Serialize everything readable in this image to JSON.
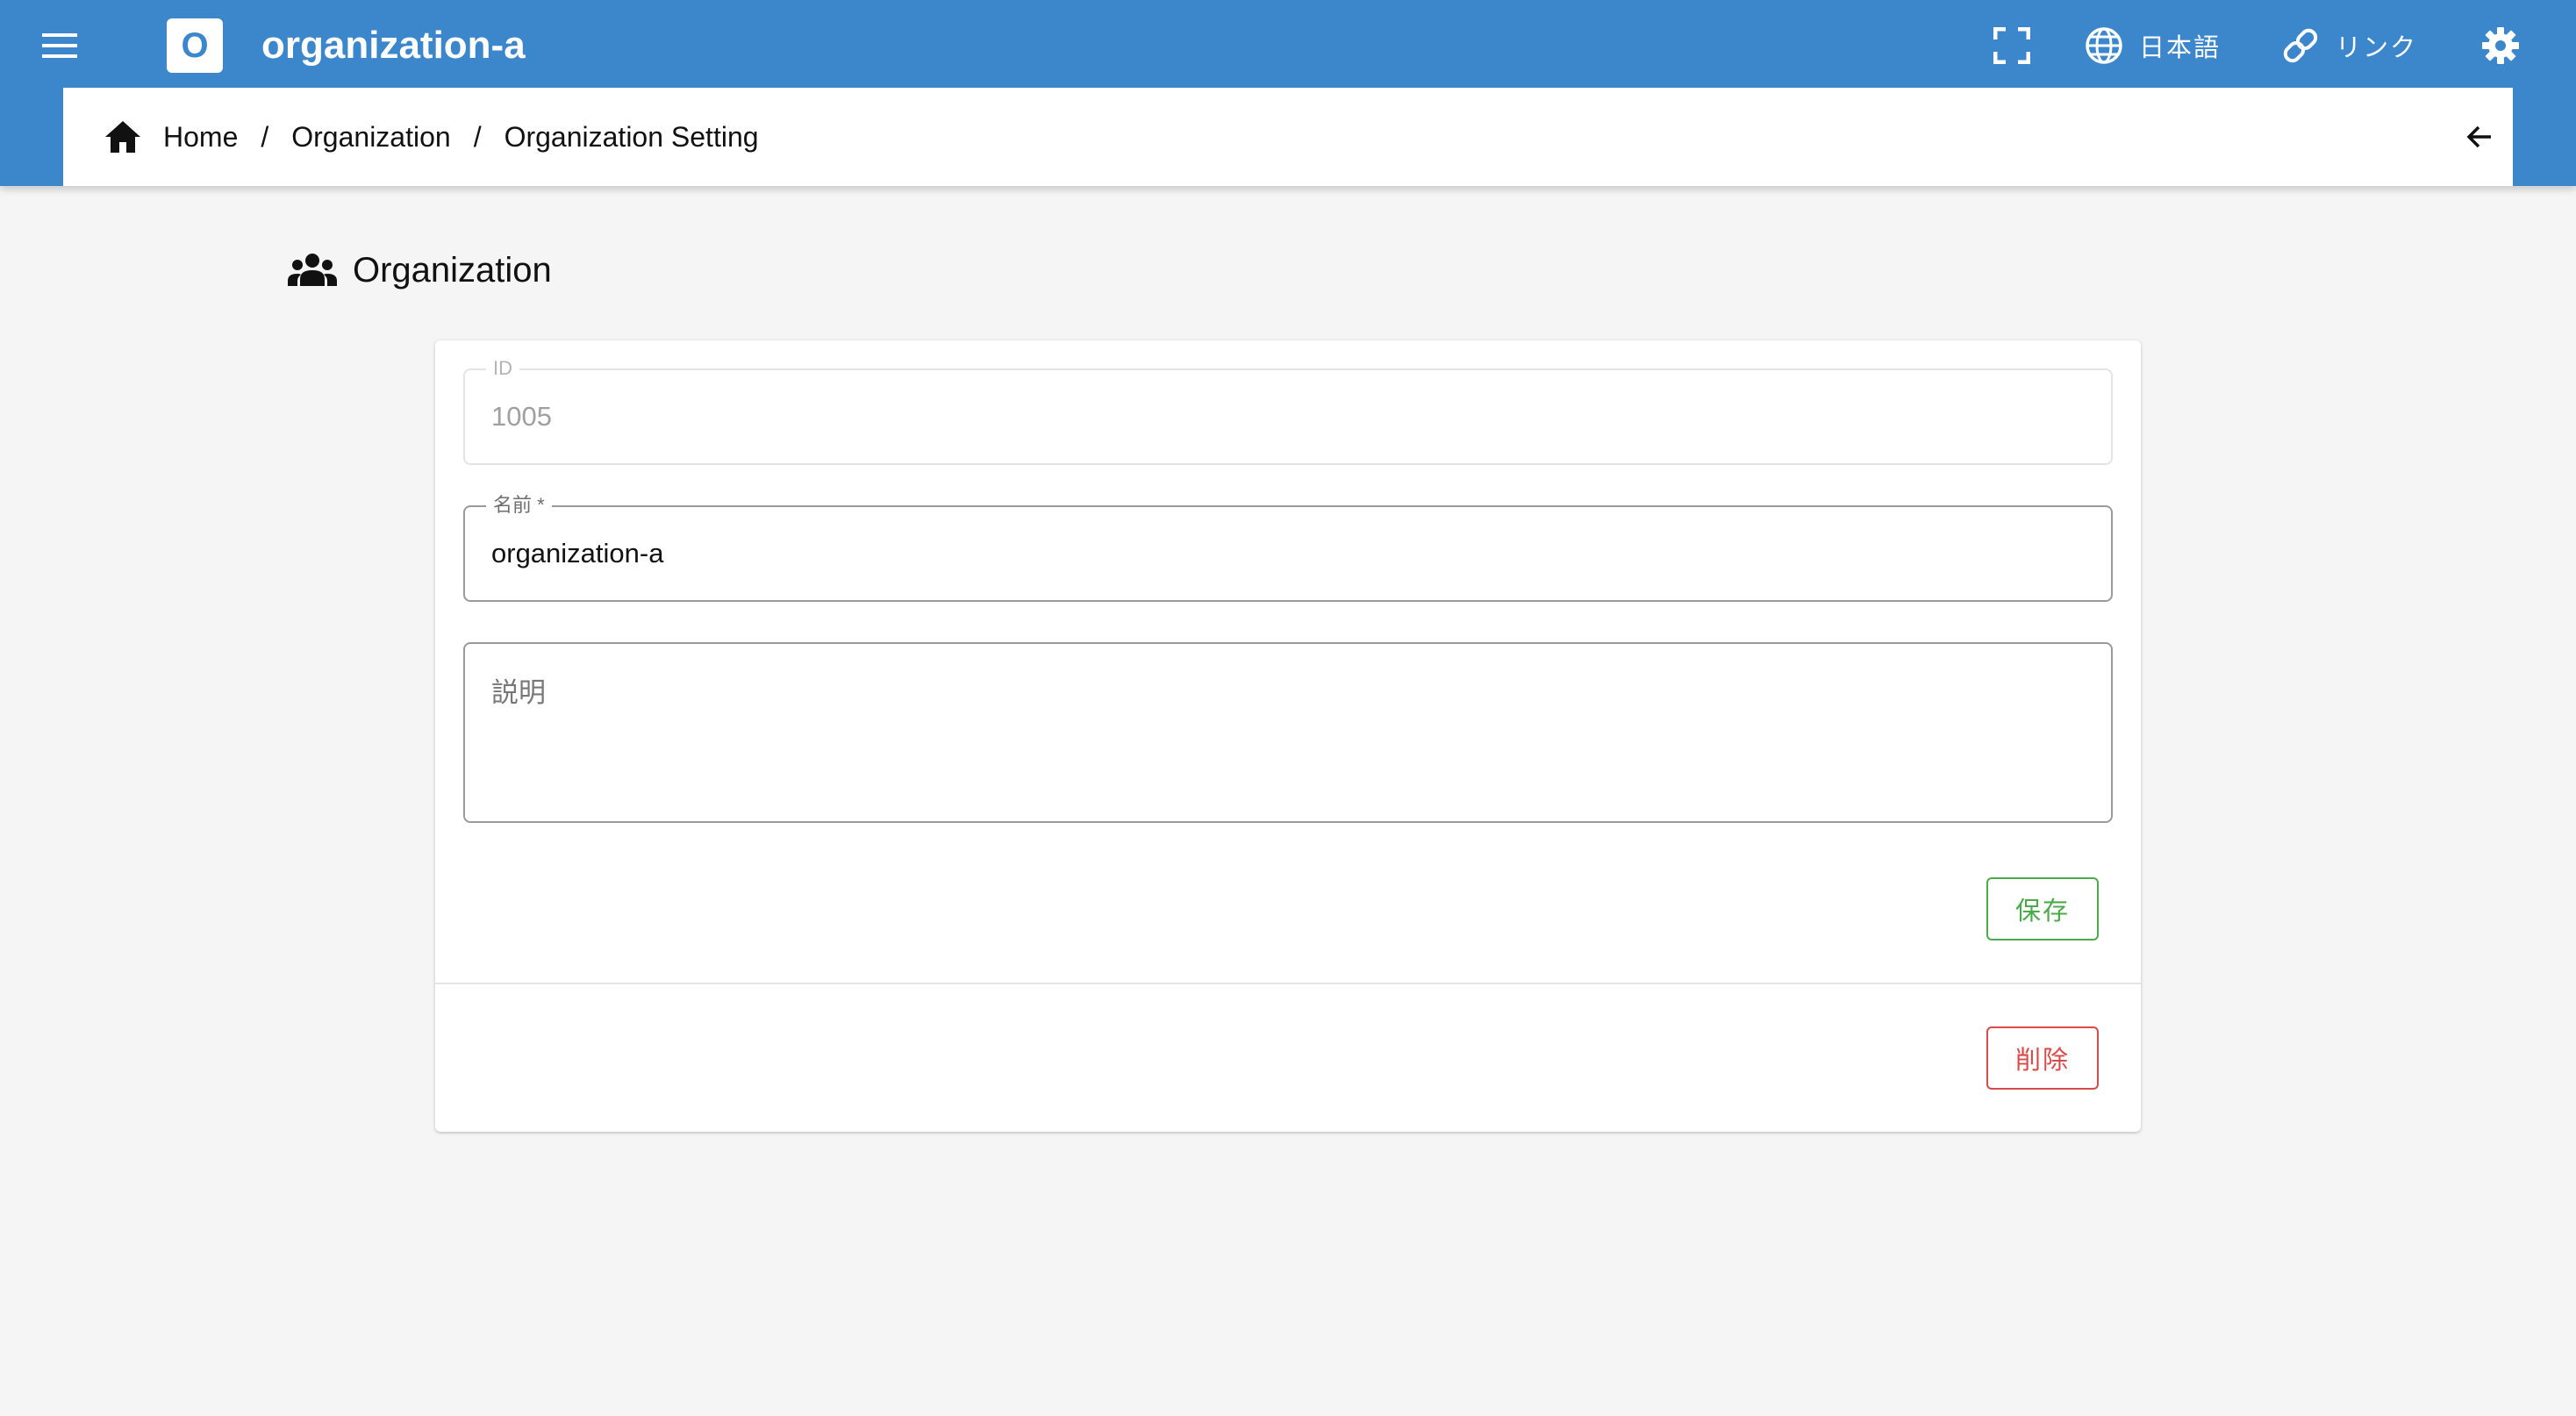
{
  "appbar": {
    "title": "organization-a",
    "logo_letter": "O",
    "language_label": "日本語",
    "link_label": "リンク",
    "icons": [
      "menu-icon",
      "fullscreen-icon",
      "globe-icon",
      "link-icon",
      "gear-icon"
    ],
    "color": "#3c87cc"
  },
  "breadcrumb": {
    "items": [
      "Home",
      "Organization",
      "Organization Setting"
    ],
    "separator": "/"
  },
  "page": {
    "heading": "Organization"
  },
  "form": {
    "id_label": "ID",
    "id_value": "1005",
    "name_label": "名前 *",
    "name_value": "organization-a",
    "description_placeholder": "説明",
    "save_label": "保存",
    "delete_label": "削除"
  },
  "colors": {
    "save": "#4caa4c",
    "delete": "#d94a4a"
  }
}
